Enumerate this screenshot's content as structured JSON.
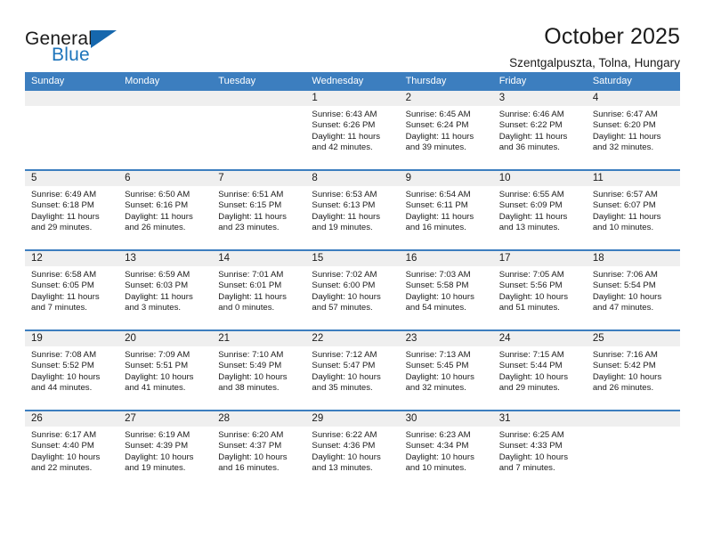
{
  "brand": {
    "word_one": "General",
    "word_two": "Blue",
    "triangle_icon": "triangle-icon"
  },
  "header": {
    "title": "October 2025",
    "subtitle": "Szentgalpuszta, Tolna, Hungary"
  },
  "colors": {
    "header_blue": "#3c7ebf",
    "brand_blue": "#1d74bb",
    "daynum_band": "#efefef",
    "text": "#1b1b1b"
  },
  "calendar": {
    "weekday_headers": [
      "Sunday",
      "Monday",
      "Tuesday",
      "Wednesday",
      "Thursday",
      "Friday",
      "Saturday"
    ],
    "weeks": [
      [
        {
          "day": "",
          "sunrise": "",
          "sunset": "",
          "daylight_line1": "",
          "daylight_line2": "",
          "empty": true
        },
        {
          "day": "",
          "sunrise": "",
          "sunset": "",
          "daylight_line1": "",
          "daylight_line2": "",
          "empty": true
        },
        {
          "day": "",
          "sunrise": "",
          "sunset": "",
          "daylight_line1": "",
          "daylight_line2": "",
          "empty": true
        },
        {
          "day": "1",
          "sunrise": "Sunrise: 6:43 AM",
          "sunset": "Sunset: 6:26 PM",
          "daylight_line1": "Daylight: 11 hours",
          "daylight_line2": "and 42 minutes."
        },
        {
          "day": "2",
          "sunrise": "Sunrise: 6:45 AM",
          "sunset": "Sunset: 6:24 PM",
          "daylight_line1": "Daylight: 11 hours",
          "daylight_line2": "and 39 minutes."
        },
        {
          "day": "3",
          "sunrise": "Sunrise: 6:46 AM",
          "sunset": "Sunset: 6:22 PM",
          "daylight_line1": "Daylight: 11 hours",
          "daylight_line2": "and 36 minutes."
        },
        {
          "day": "4",
          "sunrise": "Sunrise: 6:47 AM",
          "sunset": "Sunset: 6:20 PM",
          "daylight_line1": "Daylight: 11 hours",
          "daylight_line2": "and 32 minutes."
        }
      ],
      [
        {
          "day": "5",
          "sunrise": "Sunrise: 6:49 AM",
          "sunset": "Sunset: 6:18 PM",
          "daylight_line1": "Daylight: 11 hours",
          "daylight_line2": "and 29 minutes."
        },
        {
          "day": "6",
          "sunrise": "Sunrise: 6:50 AM",
          "sunset": "Sunset: 6:16 PM",
          "daylight_line1": "Daylight: 11 hours",
          "daylight_line2": "and 26 minutes."
        },
        {
          "day": "7",
          "sunrise": "Sunrise: 6:51 AM",
          "sunset": "Sunset: 6:15 PM",
          "daylight_line1": "Daylight: 11 hours",
          "daylight_line2": "and 23 minutes."
        },
        {
          "day": "8",
          "sunrise": "Sunrise: 6:53 AM",
          "sunset": "Sunset: 6:13 PM",
          "daylight_line1": "Daylight: 11 hours",
          "daylight_line2": "and 19 minutes."
        },
        {
          "day": "9",
          "sunrise": "Sunrise: 6:54 AM",
          "sunset": "Sunset: 6:11 PM",
          "daylight_line1": "Daylight: 11 hours",
          "daylight_line2": "and 16 minutes."
        },
        {
          "day": "10",
          "sunrise": "Sunrise: 6:55 AM",
          "sunset": "Sunset: 6:09 PM",
          "daylight_line1": "Daylight: 11 hours",
          "daylight_line2": "and 13 minutes."
        },
        {
          "day": "11",
          "sunrise": "Sunrise: 6:57 AM",
          "sunset": "Sunset: 6:07 PM",
          "daylight_line1": "Daylight: 11 hours",
          "daylight_line2": "and 10 minutes."
        }
      ],
      [
        {
          "day": "12",
          "sunrise": "Sunrise: 6:58 AM",
          "sunset": "Sunset: 6:05 PM",
          "daylight_line1": "Daylight: 11 hours",
          "daylight_line2": "and 7 minutes."
        },
        {
          "day": "13",
          "sunrise": "Sunrise: 6:59 AM",
          "sunset": "Sunset: 6:03 PM",
          "daylight_line1": "Daylight: 11 hours",
          "daylight_line2": "and 3 minutes."
        },
        {
          "day": "14",
          "sunrise": "Sunrise: 7:01 AM",
          "sunset": "Sunset: 6:01 PM",
          "daylight_line1": "Daylight: 11 hours",
          "daylight_line2": "and 0 minutes."
        },
        {
          "day": "15",
          "sunrise": "Sunrise: 7:02 AM",
          "sunset": "Sunset: 6:00 PM",
          "daylight_line1": "Daylight: 10 hours",
          "daylight_line2": "and 57 minutes."
        },
        {
          "day": "16",
          "sunrise": "Sunrise: 7:03 AM",
          "sunset": "Sunset: 5:58 PM",
          "daylight_line1": "Daylight: 10 hours",
          "daylight_line2": "and 54 minutes."
        },
        {
          "day": "17",
          "sunrise": "Sunrise: 7:05 AM",
          "sunset": "Sunset: 5:56 PM",
          "daylight_line1": "Daylight: 10 hours",
          "daylight_line2": "and 51 minutes."
        },
        {
          "day": "18",
          "sunrise": "Sunrise: 7:06 AM",
          "sunset": "Sunset: 5:54 PM",
          "daylight_line1": "Daylight: 10 hours",
          "daylight_line2": "and 47 minutes."
        }
      ],
      [
        {
          "day": "19",
          "sunrise": "Sunrise: 7:08 AM",
          "sunset": "Sunset: 5:52 PM",
          "daylight_line1": "Daylight: 10 hours",
          "daylight_line2": "and 44 minutes."
        },
        {
          "day": "20",
          "sunrise": "Sunrise: 7:09 AM",
          "sunset": "Sunset: 5:51 PM",
          "daylight_line1": "Daylight: 10 hours",
          "daylight_line2": "and 41 minutes."
        },
        {
          "day": "21",
          "sunrise": "Sunrise: 7:10 AM",
          "sunset": "Sunset: 5:49 PM",
          "daylight_line1": "Daylight: 10 hours",
          "daylight_line2": "and 38 minutes."
        },
        {
          "day": "22",
          "sunrise": "Sunrise: 7:12 AM",
          "sunset": "Sunset: 5:47 PM",
          "daylight_line1": "Daylight: 10 hours",
          "daylight_line2": "and 35 minutes."
        },
        {
          "day": "23",
          "sunrise": "Sunrise: 7:13 AM",
          "sunset": "Sunset: 5:45 PM",
          "daylight_line1": "Daylight: 10 hours",
          "daylight_line2": "and 32 minutes."
        },
        {
          "day": "24",
          "sunrise": "Sunrise: 7:15 AM",
          "sunset": "Sunset: 5:44 PM",
          "daylight_line1": "Daylight: 10 hours",
          "daylight_line2": "and 29 minutes."
        },
        {
          "day": "25",
          "sunrise": "Sunrise: 7:16 AM",
          "sunset": "Sunset: 5:42 PM",
          "daylight_line1": "Daylight: 10 hours",
          "daylight_line2": "and 26 minutes."
        }
      ],
      [
        {
          "day": "26",
          "sunrise": "Sunrise: 6:17 AM",
          "sunset": "Sunset: 4:40 PM",
          "daylight_line1": "Daylight: 10 hours",
          "daylight_line2": "and 22 minutes."
        },
        {
          "day": "27",
          "sunrise": "Sunrise: 6:19 AM",
          "sunset": "Sunset: 4:39 PM",
          "daylight_line1": "Daylight: 10 hours",
          "daylight_line2": "and 19 minutes."
        },
        {
          "day": "28",
          "sunrise": "Sunrise: 6:20 AM",
          "sunset": "Sunset: 4:37 PM",
          "daylight_line1": "Daylight: 10 hours",
          "daylight_line2": "and 16 minutes."
        },
        {
          "day": "29",
          "sunrise": "Sunrise: 6:22 AM",
          "sunset": "Sunset: 4:36 PM",
          "daylight_line1": "Daylight: 10 hours",
          "daylight_line2": "and 13 minutes."
        },
        {
          "day": "30",
          "sunrise": "Sunrise: 6:23 AM",
          "sunset": "Sunset: 4:34 PM",
          "daylight_line1": "Daylight: 10 hours",
          "daylight_line2": "and 10 minutes."
        },
        {
          "day": "31",
          "sunrise": "Sunrise: 6:25 AM",
          "sunset": "Sunset: 4:33 PM",
          "daylight_line1": "Daylight: 10 hours",
          "daylight_line2": "and 7 minutes."
        },
        {
          "day": "",
          "sunrise": "",
          "sunset": "",
          "daylight_line1": "",
          "daylight_line2": "",
          "empty": true
        }
      ]
    ]
  }
}
